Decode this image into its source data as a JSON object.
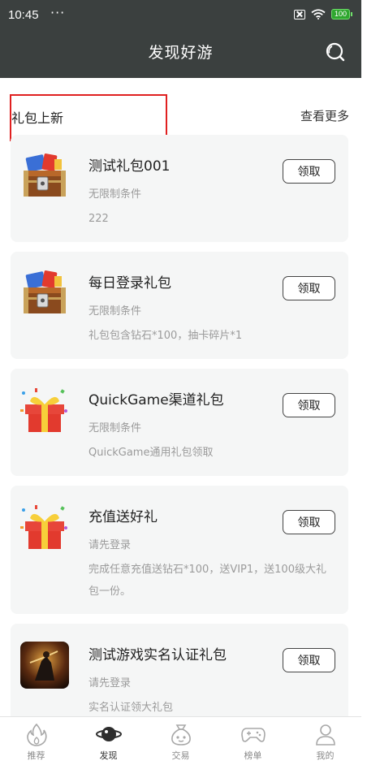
{
  "status_bar": {
    "time": "10:45",
    "dots": "···",
    "battery": "100"
  },
  "header": {
    "title": "发现好游"
  },
  "section": {
    "title": "礼包上新",
    "more": "查看更多"
  },
  "gifts": [
    {
      "name": "测试礼包001",
      "condition": "无限制条件",
      "desc": "222",
      "button": "领取",
      "icon": "treasure-chest-icon"
    },
    {
      "name": "每日登录礼包",
      "condition": "无限制条件",
      "desc": "礼包包含钻石*100，抽卡碎片*1",
      "button": "领取",
      "icon": "treasure-chest-icon"
    },
    {
      "name": "QuickGame渠道礼包",
      "condition": "无限制条件",
      "desc": "QuickGame通用礼包领取",
      "button": "领取",
      "icon": "gift-box-icon"
    },
    {
      "name": "充值送好礼",
      "condition": "请先登录",
      "desc": "完成任意充值送钻石*100，送VIP1，送100级大礼包一份。",
      "button": "领取",
      "icon": "gift-box-icon"
    },
    {
      "name": "测试游戏实名认证礼包",
      "condition": "请先登录",
      "desc": "实名认证领大礼包",
      "button": "领取",
      "icon": "game-thumbnail-icon"
    }
  ],
  "nav": [
    {
      "label": "推荐",
      "icon": "flame-icon"
    },
    {
      "label": "发现",
      "icon": "planet-icon",
      "active": true
    },
    {
      "label": "交易",
      "icon": "money-bag-icon"
    },
    {
      "label": "榜单",
      "icon": "gamepad-icon"
    },
    {
      "label": "我的",
      "icon": "person-icon"
    }
  ],
  "colors": {
    "header_bg": "#3b403f",
    "card_bg": "#f5f6f6",
    "highlight": "#e02020"
  }
}
